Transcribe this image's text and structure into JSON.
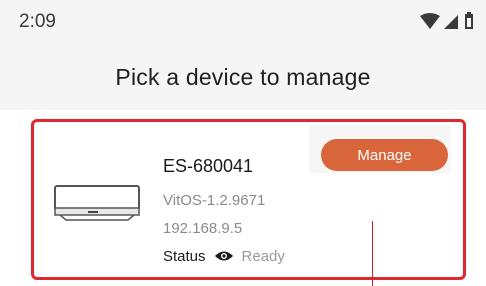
{
  "status_bar": {
    "time": "2:09",
    "icons": [
      "wifi-icon",
      "cellular-signal-icon",
      "battery-icon"
    ]
  },
  "header": {
    "title": "Pick a device to manage"
  },
  "device_card": {
    "name": "ES-680041",
    "firmware": "VitOS-1.2.9671",
    "ip": "192.168.9.5",
    "status_label": "Status",
    "status_icon": "eye-icon",
    "status_value": "Ready",
    "manage_label": "Manage"
  },
  "colors": {
    "highlight_border": "#e0262f",
    "manage_button": "#d9653a",
    "header_background": "#f5f5f5"
  }
}
